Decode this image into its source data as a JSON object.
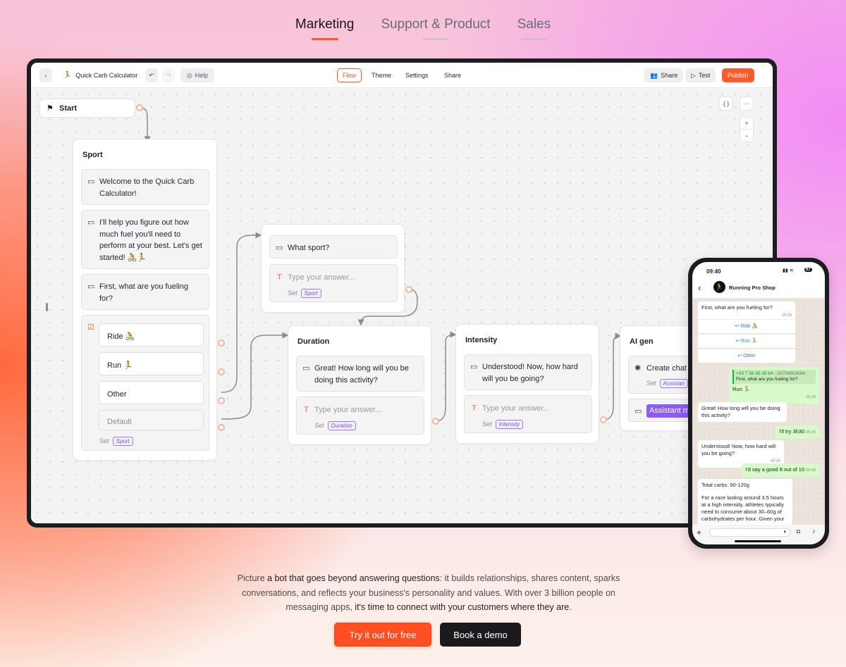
{
  "tabs": [
    {
      "label": "Marketing",
      "active": true
    },
    {
      "label": "Support & Product",
      "active": false
    },
    {
      "label": "Sales",
      "active": false
    }
  ],
  "editor": {
    "bot_name": "Quick Carb Calculator",
    "help": "Help",
    "nav": [
      "Flow",
      "Theme",
      "Settings",
      "Share"
    ],
    "share_btn": "Share",
    "test_btn": "Test",
    "publish_btn": "Publish",
    "json_btn": "{ }",
    "more_btn": "···",
    "zoom_in": "+",
    "zoom_out": "−"
  },
  "flow": {
    "start": "Start",
    "sport": {
      "title": "Sport",
      "messages": [
        "Welcome to the Quick Carb Calculator!",
        "I'll help you figure out how much fuel you'll need to perform at your best. Let's get started! 🚴🏃",
        "First, what are you fueling for?"
      ],
      "buttons": [
        "Ride 🚴",
        "Run 🏃",
        "Other"
      ],
      "default": "Default",
      "set": "Set",
      "var": "Sport"
    },
    "what_sport": {
      "question": "What sport?",
      "placeholder": "Type your answer...",
      "set": "Set",
      "var": "Sport"
    },
    "duration": {
      "title": "Duration",
      "message": "Great! How long will you be doing this activity?",
      "placeholder": "Type your answer...",
      "set": "Set",
      "var": "Duration"
    },
    "intensity": {
      "title": "Intensity",
      "message": "Understood! Now, how hard will you be going?",
      "placeholder": "Type your answer...",
      "set": "Set",
      "var": "Intensity"
    },
    "ai_gen": {
      "title": "AI gen",
      "action": "Create chat",
      "set": "Set",
      "var": "Assistan",
      "assistant": "Assistant m"
    }
  },
  "phone": {
    "time": "09:40",
    "battery": "97",
    "contact": "Running Pro Shop",
    "q1": {
      "text": "First, what are you fueling for?",
      "time": "09:39"
    },
    "options": [
      "Ride 🚴",
      "Run 🏃",
      "Other"
    ],
    "reply1": {
      "quote_num": "+33 7 56 95 36 64",
      "quote_alt": "~33756953664",
      "quote_text": "First, what are you fueling for?",
      "text": "Run 🏃",
      "time": "09:39"
    },
    "q2": {
      "text": "Great! How long will you be doing this activity?",
      "time": "09:39"
    },
    "reply2": {
      "text": "I'll try 3h30",
      "time": "09:39"
    },
    "q3": {
      "text": "Understood! Now, how hard will you be going?",
      "time": "09:39"
    },
    "reply3": {
      "text": "I'd say a good 8 out of 10",
      "time": "09:39"
    },
    "result": {
      "line1": "Total carbs: 90-120g",
      "line2": "For a race lasting around 3.5 hours at a high intensity, athletes typically need to consume about 30–60g of carbohydrates per hour. Given your"
    }
  },
  "bottom": {
    "p1": "Picture ",
    "p1b": "a bot that goes beyond answering questions",
    "p2": ": it builds relationships, shares content, sparks conversations, and reflects your business's personality and values. With over 3 billion people on messaging apps, ",
    "p2b": "it's time to connect with your customers where they are",
    "p3": ".",
    "cta_primary": "Try it out for free",
    "cta_secondary": "Book a demo"
  },
  "colors": {
    "accent": "#ff5a2c",
    "variable": "#7a4fe0",
    "whatsapp_out": "#d6fac8"
  }
}
